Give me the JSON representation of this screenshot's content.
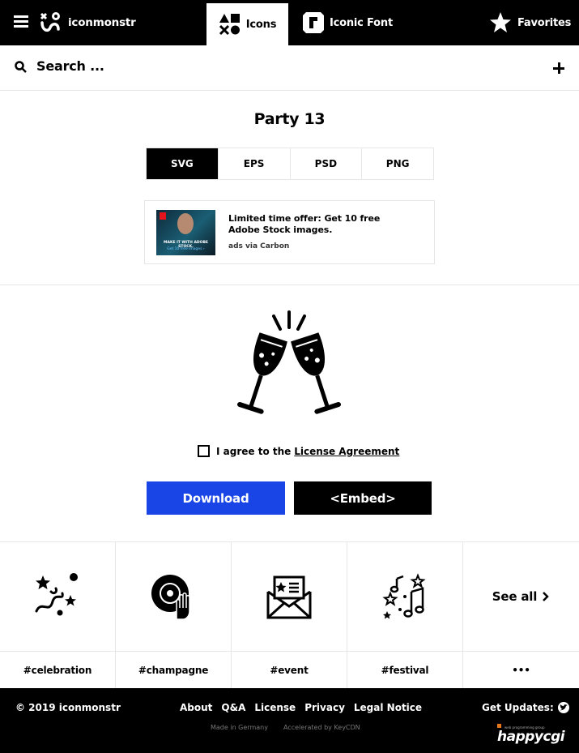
{
  "brand": {
    "name": "iconmonstr"
  },
  "nav": {
    "icons_label": "Icons",
    "font_label": "Iconic Font",
    "favorites_label": "Favorites"
  },
  "search": {
    "placeholder": "Search ..."
  },
  "page": {
    "title": "Party 13"
  },
  "formats": [
    "SVG",
    "EPS",
    "PSD",
    "PNG"
  ],
  "ad": {
    "image_line1": "MAKE IT WITH ADOBE STOCK.",
    "image_line2": "Get 10 free images ›",
    "text": "Limited time offer: Get 10 free Adobe Stock images.",
    "via": "ads via Carbon"
  },
  "license": {
    "agree_prefix": "I agree to the",
    "link": "License Agreement"
  },
  "actions": {
    "download": "Download",
    "embed": "<Embed>"
  },
  "related": {
    "tags": [
      "#celebration",
      "#champagne",
      "#event",
      "#festival"
    ],
    "see_all": "See all",
    "more": "•••"
  },
  "footer": {
    "copyright": "© 2019 iconmonstr",
    "links": [
      "About",
      "Q&A",
      "License",
      "Privacy",
      "Legal Notice"
    ],
    "updates": "Get Updates:",
    "made": "Made in Germany",
    "accel": "Accelerated by KeyCDN",
    "sponsor_small": "web programming group",
    "sponsor": "happycgi"
  },
  "colors": {
    "download_button": "#1a45e6",
    "topbar": "#000000"
  }
}
